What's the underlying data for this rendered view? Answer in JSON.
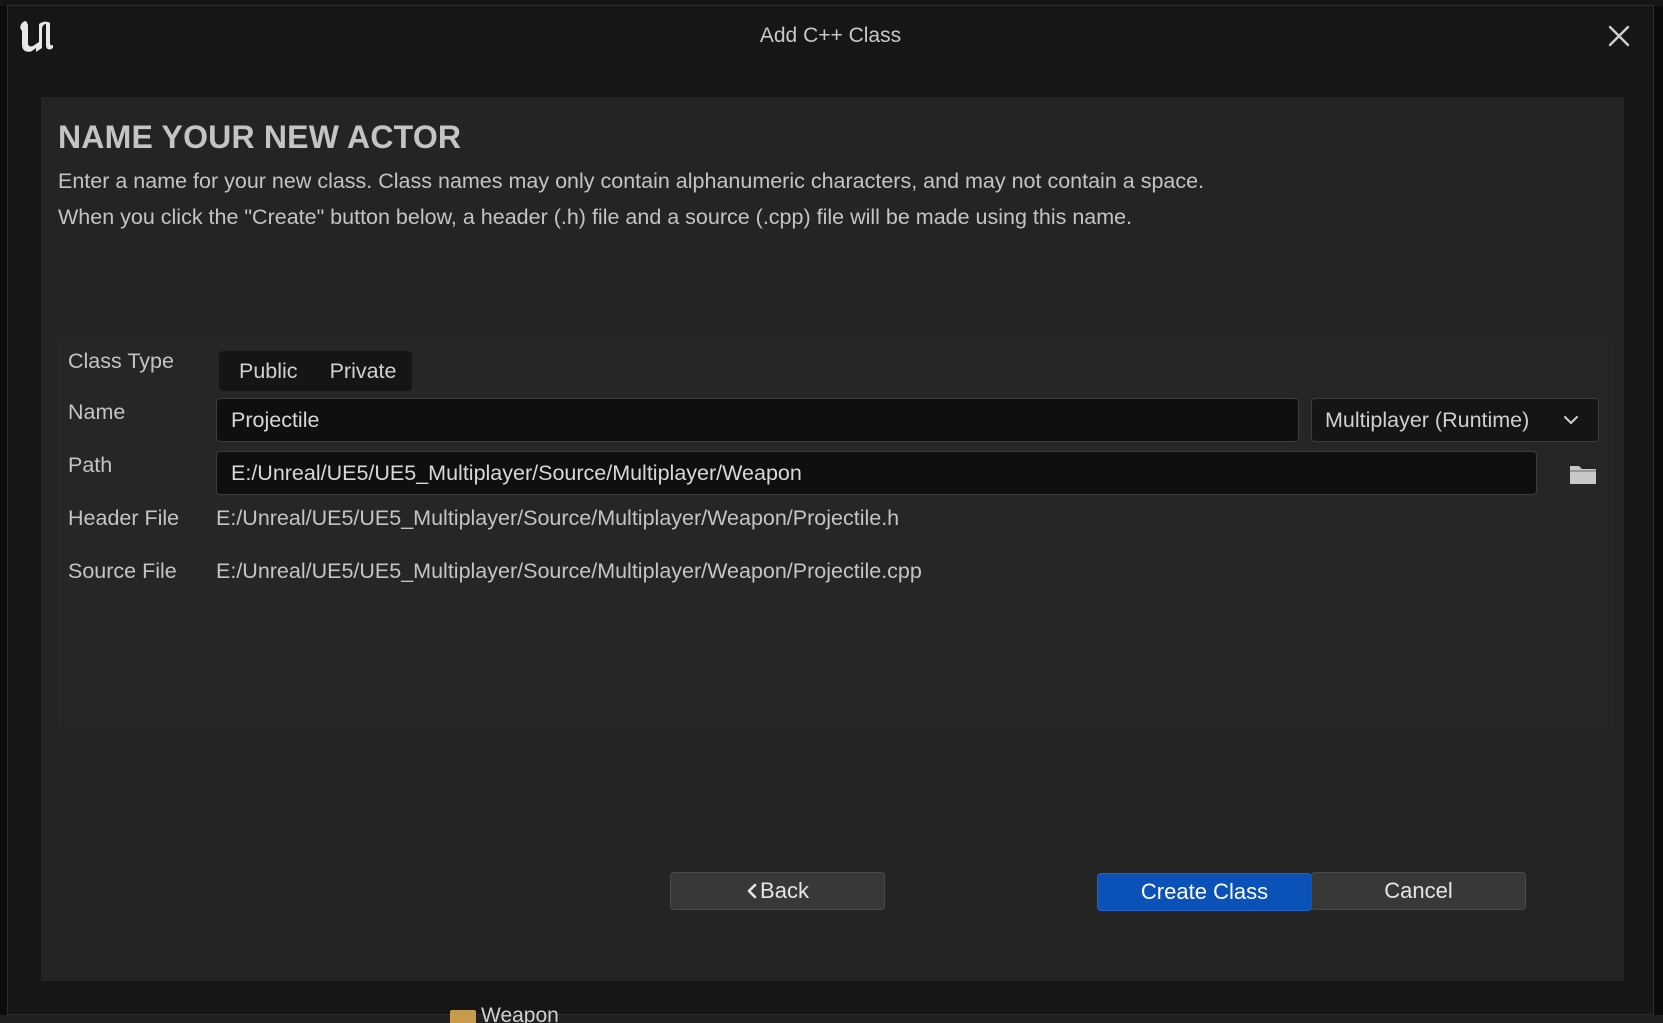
{
  "window": {
    "title": "Add C++ Class",
    "logo_icon": "unreal-engine-logo",
    "close_icon": "close-icon"
  },
  "page": {
    "heading": "NAME YOUR NEW ACTOR",
    "description_line1": "Enter a name for your new class. Class names may only contain alphanumeric characters, and may not contain a space.",
    "description_line2": "When you click the \"Create\" button below, a header (.h) file and a source (.cpp) file will be made using this name."
  },
  "form": {
    "class_type_label": "Class Type",
    "class_type_options": [
      "Public",
      "Private"
    ],
    "name_label": "Name",
    "name_value": "Projectile",
    "module_selected": "Multiplayer (Runtime)",
    "path_label": "Path",
    "path_value": "E:/Unreal/UE5/UE5_Multiplayer/Source/Multiplayer/Weapon",
    "header_file_label": "Header File",
    "header_file_value": "E:/Unreal/UE5/UE5_Multiplayer/Source/Multiplayer/Weapon/Projectile.h",
    "source_file_label": "Source File",
    "source_file_value": "E:/Unreal/UE5/UE5_Multiplayer/Source/Multiplayer/Weapon/Projectile.cpp"
  },
  "buttons": {
    "back": "Back",
    "create": "Create Class",
    "cancel": "Cancel"
  },
  "background": {
    "folder_label": "Weapon"
  },
  "colors": {
    "primary_button": "#0a51b8",
    "panel": "#242424",
    "window": "#161616"
  }
}
